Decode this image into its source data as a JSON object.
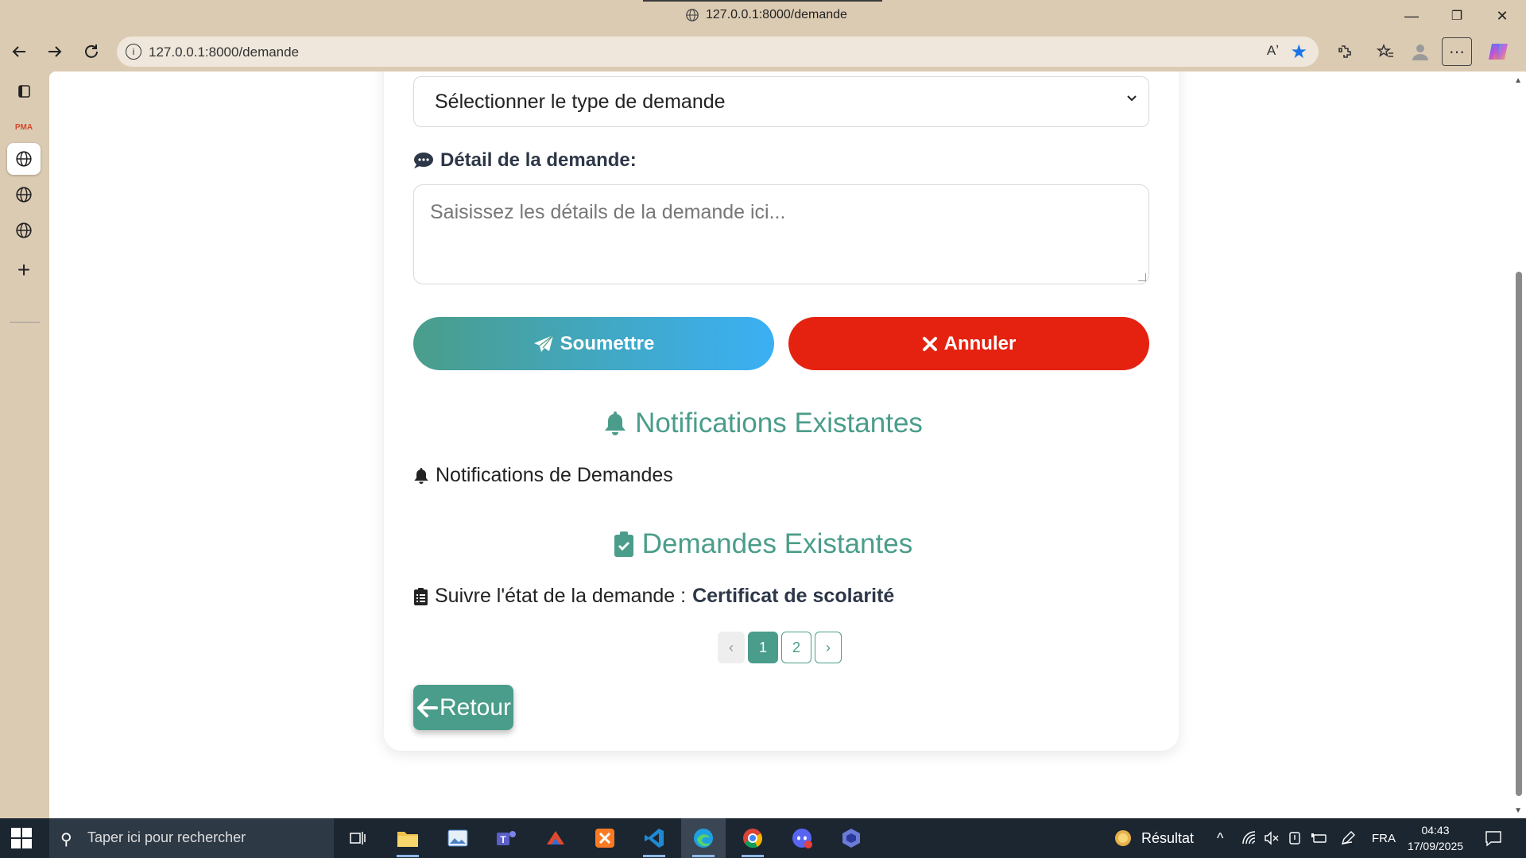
{
  "browser": {
    "tab_title": "127.0.0.1:8000/demande",
    "url": "127.0.0.1:8000/demande",
    "read_aloud": "Aʼ",
    "window_controls": {
      "minimize": "—",
      "restore": "❐",
      "close": "✕"
    }
  },
  "sidebar": {
    "items": [
      {
        "name": "tabs-icon",
        "glyph": "❐"
      },
      {
        "name": "pma-icon",
        "glyph": "PMA"
      },
      {
        "name": "globe-icon",
        "glyph": "🌐"
      },
      {
        "name": "globe-icon",
        "glyph": "🌐"
      },
      {
        "name": "globe-icon",
        "glyph": "🌐"
      },
      {
        "name": "add-icon",
        "glyph": "+"
      }
    ]
  },
  "form": {
    "select_value": "Sélectionner le type de demande",
    "detail_label": "Détail de la demande:",
    "detail_placeholder": "Saisissez les détails de la demande ici...",
    "submit_label": "Soumettre",
    "cancel_label": "Annuler"
  },
  "notifications": {
    "heading": "Notifications Existantes",
    "item": "Notifications de Demandes"
  },
  "demandes": {
    "heading": "Demandes Existantes",
    "item_prefix": "Suivre l'état de la demande :",
    "item_type": "Certificat de scolarité"
  },
  "pagination": {
    "prev": "‹",
    "pages": [
      "1",
      "2"
    ],
    "current": "1",
    "next": "›"
  },
  "back_label": "Retour",
  "taskbar": {
    "search_placeholder": "Taper ici pour rechercher",
    "weather_label": "Résultat",
    "language": "FRA",
    "time": "04:43",
    "date": "17/09/2025"
  },
  "colors": {
    "accent": "#4a9d8a",
    "cancel": "#e52210",
    "submit_end": "#3ab0f5"
  }
}
